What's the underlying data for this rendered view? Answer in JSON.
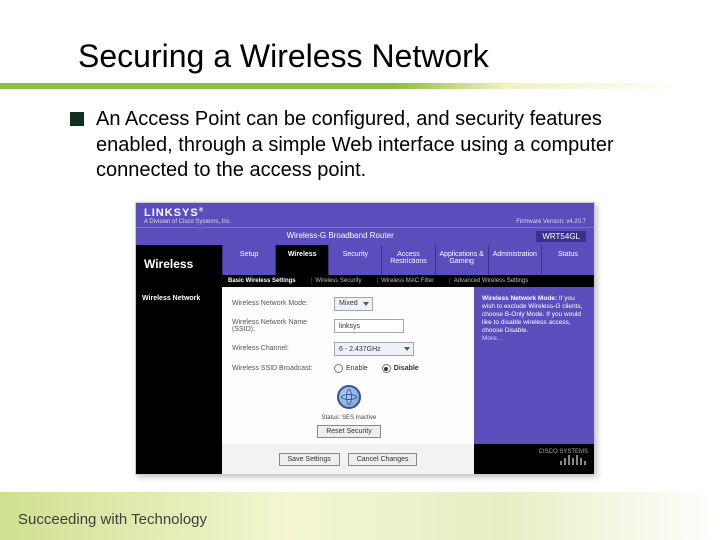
{
  "slide": {
    "title": "Securing a Wireless Network",
    "bullet": "An Access Point can be configured, and security features enabled, through a simple Web interface using a computer connected to the access point.",
    "footer": "Succeeding with Technology"
  },
  "router": {
    "brand": "LINKSYS",
    "brand_sub": "A Division of Cisco Systems, Inc.",
    "firmware": "Firmware Version: v4.20.7",
    "product_title": "Wireless-G Broadband Router",
    "model": "WRT54GL",
    "side_label": "Wireless",
    "tabs": [
      "Setup",
      "Wireless",
      "Security",
      "Access Restrictions",
      "Applications & Gaming",
      "Administration",
      "Status"
    ],
    "active_tab_index": 1,
    "subtabs": [
      "Basic Wireless Settings",
      "Wireless Security",
      "Wireless MAC Filter",
      "Advanced Wireless Settings"
    ],
    "active_subtab_index": 0,
    "section_label": "Wireless Network",
    "fields": {
      "mode_label": "Wireless Network Mode:",
      "mode_value": "Mixed",
      "ssid_label": "Wireless Network Name (SSID):",
      "ssid_value": "linksys",
      "channel_label": "Wireless Channel:",
      "channel_value": "6 - 2.437GHz",
      "broadcast_label": "Wireless SSID Broadcast:",
      "broadcast_enable": "Enable",
      "broadcast_disable": "Disable"
    },
    "status_line": "Status: SES Inactive",
    "reset_button": "Reset Security",
    "save_button": "Save Settings",
    "cancel_button": "Cancel Changes",
    "help_html_1": "Wireless Network Mode:",
    "help_html_2": "If you wish to exclude Wireless-G clients, choose B-Only Mode. If you would like to disable wireless access, choose Disable.",
    "help_more": "More...",
    "cisco_label": "CISCO SYSTEMS"
  }
}
